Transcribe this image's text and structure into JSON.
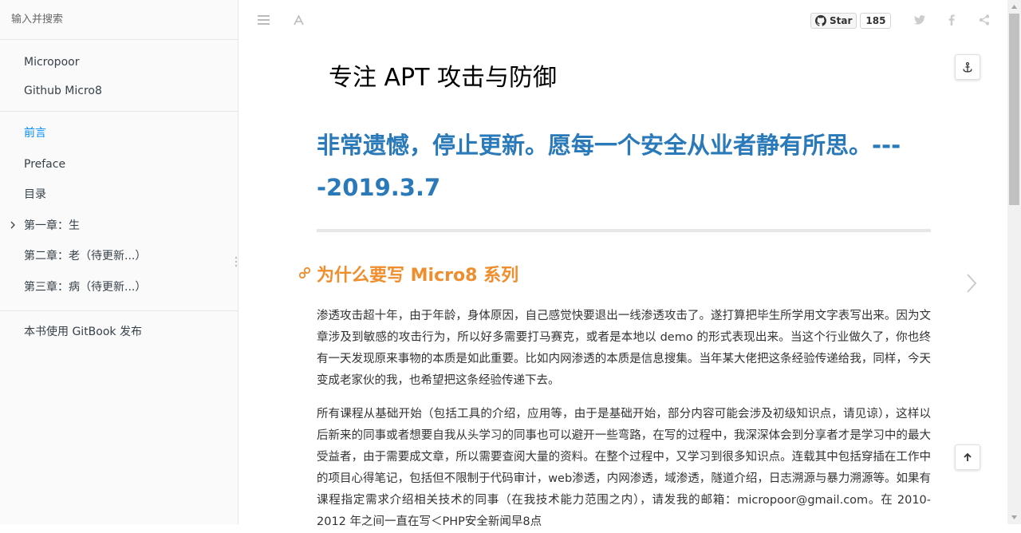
{
  "search": {
    "placeholder": "输入并搜索"
  },
  "sidebar": {
    "top_links": [
      {
        "label": "Micropoor"
      },
      {
        "label": "Github Micro8"
      }
    ],
    "chapters": [
      {
        "label": "前言",
        "active": true
      },
      {
        "label": "Preface"
      },
      {
        "label": "目录"
      },
      {
        "label": "第一章：生",
        "expandable": true
      },
      {
        "label": "第二章：老（待更新...）"
      },
      {
        "label": "第三章：病（待更新...）"
      }
    ],
    "footer_link": "本书使用 GitBook 发布"
  },
  "toolbar": {
    "github_star_label": "Star",
    "github_star_count": "185",
    "icons": [
      "menu-icon",
      "font-settings-icon",
      "github-icon",
      "twitter-icon",
      "facebook-icon",
      "share-icon"
    ]
  },
  "content": {
    "page_title": "专注 APT 攻击与防御",
    "heading1": "非常遗憾，停止更新。愿每一个安全从业者静有所思。----2019.3.7",
    "heading2": "为什么要写 Micro8 系列",
    "paragraph1": "渗透攻击超十年，由于年龄，身体原因，自己感觉快要退出一线渗透攻击了。遂打算把毕生所学用文字表写出来。因为文章涉及到敏感的攻击行为，所以好多需要打马赛克，或者是本地以 demo 的形式表现出来。当这个行业做久了，你也终有一天发现原来事物的本质是如此重要。比如内网渗透的本质是信息搜集。当年某大佬把这条经验传递给我，同样，今天变成老家伙的我，也希望把这条经验传递下去。",
    "paragraph2": "所有课程从基础开始（包括工具的介绍，应用等，由于是基础开始，部分内容可能会涉及初级知识点，请见谅），这样以后新来的同事或者想要自我从头学习的同事也可以避开一些弯路，在写的过程中，我深深体会到分享者才是学习中的最大受益者，由于需要成文章，所以需要查阅大量的资料。在整个过程中，又学习到很多知识点。连载其中包括穿插在工作中的项目心得笔记，包括但不限制于代码审计，web渗透，内网渗透，域渗透，隧道介绍，日志溯源与暴力溯源等。如果有课程指定需求介绍相关技术的同事（在我技术能力范围之内），请发我的邮箱：micropoor@gmail.com。在 2010-2012 年之间一直在写＜PHP安全新闻早8点"
  },
  "colors": {
    "accent_link": "#008cff",
    "heading1": "#2a79b9",
    "heading2": "#f08d2c"
  }
}
